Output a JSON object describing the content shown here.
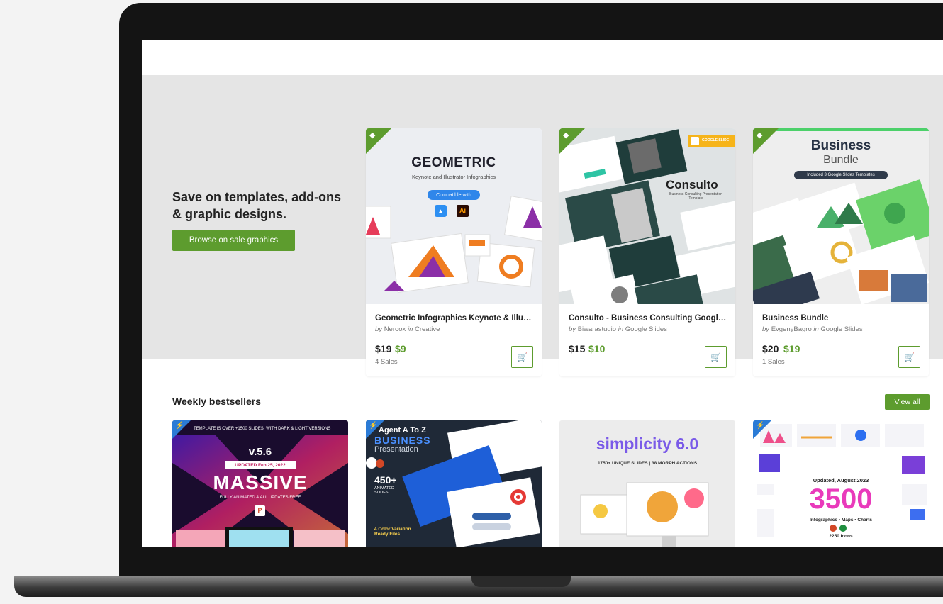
{
  "promo": {
    "title": "Save on templates, add-ons & graphic designs.",
    "button": "Browse on sale graphics"
  },
  "sale_cards": [
    {
      "title": "Geometric Infographics Keynote & Illust...",
      "author": "Neroox",
      "category": "Creative",
      "old_price": "$19",
      "new_price": "$9",
      "sales": "4 Sales",
      "thumb": {
        "heading": "GEOMETRIC",
        "sub": "Keynote and Illustrator Infographics",
        "chip": "Compatible with"
      }
    },
    {
      "title": "Consulto - Business Consulting Google ...",
      "author": "Biwarastudio",
      "category": "Google Slides",
      "old_price": "$15",
      "new_price": "$10",
      "sales": "",
      "thumb": {
        "heading": "Consulto",
        "sub": "Business Consulting Presentation Template",
        "chip": "GOOGLE SLIDE"
      }
    },
    {
      "title": "Business Bundle",
      "author": "EvgenyBagro",
      "category": "Google Slides",
      "old_price": "$20",
      "new_price": "$19",
      "sales": "1 Sales",
      "thumb": {
        "heading": "Business",
        "sub": "Bundle",
        "chip": "Included 3 Google Slides Templates"
      }
    }
  ],
  "bestsellers": {
    "title": "Weekly bestsellers",
    "view_all": "View all",
    "items": [
      {
        "banner": "TEMPLATE IS OVER +1500 SLIDES, WITH DARK & LIGHT VERSIONS",
        "version": "v.5.6",
        "updated": "UPDATED Feb 25, 2022",
        "heading": "MASSIVE",
        "sub": "FULLY ANIMATED & ALL UPDATES FREE"
      },
      {
        "line1": "Agent A To Z",
        "line2": "BUSINESS",
        "line3": "Presentation",
        "count": "450+",
        "count_label": "ANIMATED SLIDES",
        "footer": "4 Color Variation Ready Files"
      },
      {
        "heading": "simplicity 6.0",
        "sub": "1750+ UNIQUE SLIDES | 38 MORPH ACTIONS"
      },
      {
        "updated": "Updated, August 2023",
        "heading": "3500",
        "sub": "Infographics • Maps • Charts",
        "icons": "2250 Icons"
      }
    ]
  },
  "colors": {
    "accent": "#5d9c2e",
    "bolt": "#2b7bd6"
  }
}
